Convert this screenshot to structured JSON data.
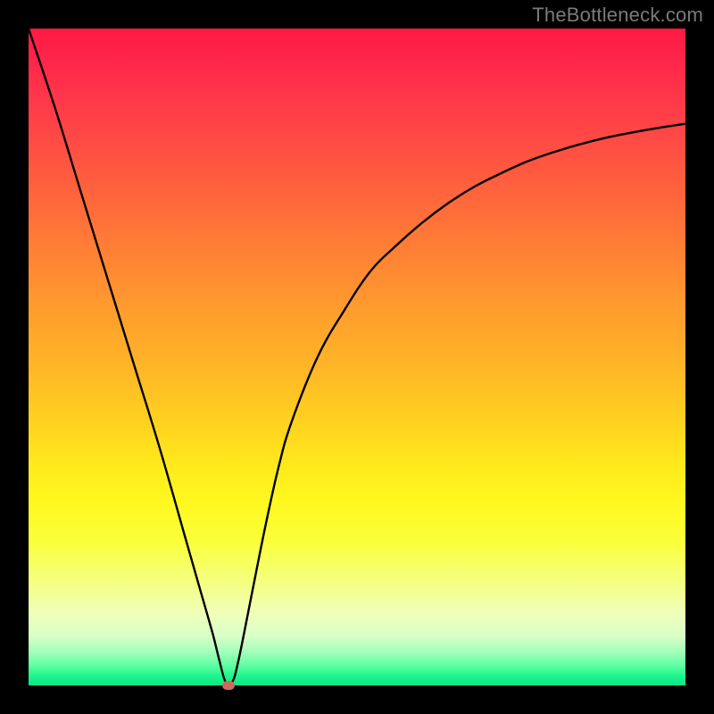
{
  "watermark": "TheBottleneck.com",
  "colors": {
    "frame": "#000000",
    "curve": "#000000",
    "marker": "#cc6a5e"
  },
  "chart_data": {
    "type": "line",
    "title": "",
    "xlabel": "",
    "ylabel": "",
    "xlim": [
      0,
      100
    ],
    "ylim": [
      0,
      100
    ],
    "x": [
      0,
      4,
      8,
      12,
      16,
      20,
      24,
      26,
      28,
      29,
      30,
      31,
      32,
      34,
      36,
      38,
      40,
      44,
      48,
      52,
      56,
      60,
      64,
      68,
      72,
      76,
      80,
      84,
      88,
      92,
      96,
      100
    ],
    "series": [
      {
        "name": "bottleneck-curve",
        "values": [
          100,
          88,
          75,
          62,
          49,
          36,
          22,
          15,
          8,
          4,
          0.5,
          0.5,
          4,
          14,
          24,
          33,
          40,
          50,
          57,
          63,
          67,
          70.5,
          73.5,
          76,
          78,
          79.8,
          81.2,
          82.4,
          83.4,
          84.2,
          84.9,
          85.5
        ]
      }
    ],
    "marker": {
      "x": 30.5,
      "y": 0
    },
    "background_gradient": {
      "top": "#ff1a44",
      "mid": "#ffe81c",
      "bottom": "#08e884"
    },
    "grid": false,
    "legend": false
  }
}
